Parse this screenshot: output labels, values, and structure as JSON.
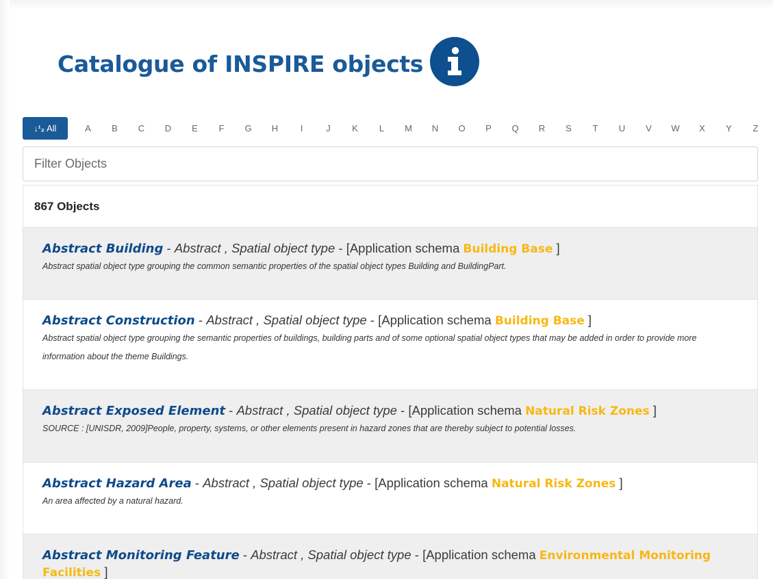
{
  "page": {
    "title": "Catalogue of INSPIRE objects",
    "info_icon": "info-icon"
  },
  "alphabet": {
    "all_label": "All",
    "all_icon": "sort-icon",
    "letters": [
      "A",
      "B",
      "C",
      "D",
      "E",
      "F",
      "G",
      "H",
      "I",
      "J",
      "K",
      "L",
      "M",
      "N",
      "O",
      "P",
      "Q",
      "R",
      "S",
      "T",
      "U",
      "V",
      "W",
      "X",
      "Y",
      "Z"
    ]
  },
  "filter": {
    "placeholder": "Filter Objects",
    "value": ""
  },
  "results": {
    "count_label": "867 Objects",
    "items": [
      {
        "name": "Abstract Building",
        "sep1": " - ",
        "meta": "Abstract , Spatial object type",
        "sep2": " - [Application schema ",
        "schema": "Building Base",
        "close": " ]",
        "description": "Abstract spatial object type grouping the common semantic properties of the spatial object types Building and BuildingPart."
      },
      {
        "name": "Abstract Construction",
        "sep1": " - ",
        "meta": "Abstract , Spatial object type",
        "sep2": " - [Application schema ",
        "schema": "Building Base",
        "close": " ]",
        "description": "Abstract spatial object type grouping the semantic properties of buildings, building parts and of some optional spatial object types that may be added in order to provide more information about the theme Buildings."
      },
      {
        "name": "Abstract Exposed Element",
        "sep1": " - ",
        "meta": "Abstract , Spatial object type",
        "sep2": " - [Application schema ",
        "schema": "Natural Risk Zones",
        "close": " ]",
        "description": "SOURCE : [UNISDR, 2009]People, property, systems, or other elements present in hazard zones that are thereby subject to potential losses."
      },
      {
        "name": "Abstract Hazard Area",
        "sep1": " - ",
        "meta": "Abstract , Spatial object type",
        "sep2": " - [Application schema ",
        "schema": "Natural Risk Zones",
        "close": " ]",
        "description": "An area affected by a natural hazard."
      },
      {
        "name": "Abstract Monitoring Feature",
        "sep1": " - ",
        "meta": "Abstract , Spatial object type",
        "sep2": " - [Application schema ",
        "schema": "Environmental Monitoring Facilities",
        "close": " ]",
        "description": ""
      }
    ]
  },
  "colors": {
    "title_blue": "#1a5a98",
    "name_blue": "#0e4a8a",
    "schema_yellow": "#f7b813",
    "row_shade": "#efefef"
  }
}
